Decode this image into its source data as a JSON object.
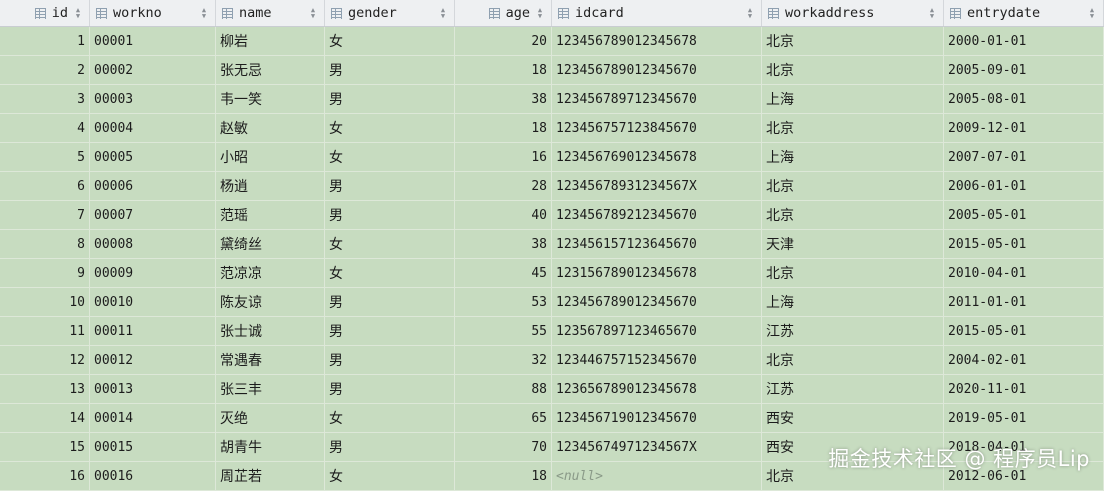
{
  "columns": [
    {
      "key": "id",
      "label": "id"
    },
    {
      "key": "workno",
      "label": "workno"
    },
    {
      "key": "name",
      "label": "name"
    },
    {
      "key": "gender",
      "label": "gender"
    },
    {
      "key": "age",
      "label": "age"
    },
    {
      "key": "idcard",
      "label": "idcard"
    },
    {
      "key": "workaddress",
      "label": "workaddress"
    },
    {
      "key": "entrydate",
      "label": "entrydate"
    }
  ],
  "rows": [
    {
      "id": "1",
      "workno": "00001",
      "name": "柳岩",
      "gender": "女",
      "age": "20",
      "idcard": "123456789012345678",
      "workaddress": "北京",
      "entrydate": "2000-01-01"
    },
    {
      "id": "2",
      "workno": "00002",
      "name": "张无忌",
      "gender": "男",
      "age": "18",
      "idcard": "123456789012345670",
      "workaddress": "北京",
      "entrydate": "2005-09-01"
    },
    {
      "id": "3",
      "workno": "00003",
      "name": "韦一笑",
      "gender": "男",
      "age": "38",
      "idcard": "123456789712345670",
      "workaddress": "上海",
      "entrydate": "2005-08-01"
    },
    {
      "id": "4",
      "workno": "00004",
      "name": "赵敏",
      "gender": "女",
      "age": "18",
      "idcard": "123456757123845670",
      "workaddress": "北京",
      "entrydate": "2009-12-01"
    },
    {
      "id": "5",
      "workno": "00005",
      "name": "小昭",
      "gender": "女",
      "age": "16",
      "idcard": "123456769012345678",
      "workaddress": "上海",
      "entrydate": "2007-07-01"
    },
    {
      "id": "6",
      "workno": "00006",
      "name": "杨逍",
      "gender": "男",
      "age": "28",
      "idcard": "12345678931234567X",
      "workaddress": "北京",
      "entrydate": "2006-01-01"
    },
    {
      "id": "7",
      "workno": "00007",
      "name": "范瑶",
      "gender": "男",
      "age": "40",
      "idcard": "123456789212345670",
      "workaddress": "北京",
      "entrydate": "2005-05-01"
    },
    {
      "id": "8",
      "workno": "00008",
      "name": "黛绮丝",
      "gender": "女",
      "age": "38",
      "idcard": "123456157123645670",
      "workaddress": "天津",
      "entrydate": "2015-05-01"
    },
    {
      "id": "9",
      "workno": "00009",
      "name": "范凉凉",
      "gender": "女",
      "age": "45",
      "idcard": "123156789012345678",
      "workaddress": "北京",
      "entrydate": "2010-04-01"
    },
    {
      "id": "10",
      "workno": "00010",
      "name": "陈友谅",
      "gender": "男",
      "age": "53",
      "idcard": "123456789012345670",
      "workaddress": "上海",
      "entrydate": "2011-01-01"
    },
    {
      "id": "11",
      "workno": "00011",
      "name": "张士诚",
      "gender": "男",
      "age": "55",
      "idcard": "123567897123465670",
      "workaddress": "江苏",
      "entrydate": "2015-05-01"
    },
    {
      "id": "12",
      "workno": "00012",
      "name": "常遇春",
      "gender": "男",
      "age": "32",
      "idcard": "123446757152345670",
      "workaddress": "北京",
      "entrydate": "2004-02-01"
    },
    {
      "id": "13",
      "workno": "00013",
      "name": "张三丰",
      "gender": "男",
      "age": "88",
      "idcard": "123656789012345678",
      "workaddress": "江苏",
      "entrydate": "2020-11-01"
    },
    {
      "id": "14",
      "workno": "00014",
      "name": "灭绝",
      "gender": "女",
      "age": "65",
      "idcard": "123456719012345670",
      "workaddress": "西安",
      "entrydate": "2019-05-01"
    },
    {
      "id": "15",
      "workno": "00015",
      "name": "胡青牛",
      "gender": "男",
      "age": "70",
      "idcard": "12345674971234567X",
      "workaddress": "西安",
      "entrydate": "2018-04-01"
    },
    {
      "id": "16",
      "workno": "00016",
      "name": "周芷若",
      "gender": "女",
      "age": "18",
      "idcard": "<null>",
      "workaddress": "北京",
      "entrydate": "2012-06-01"
    }
  ],
  "watermark": "掘金技术社区 @ 程序员Lip",
  "colors": {
    "row_bg": "#c7dcc0",
    "header_bg": "#eef0f2",
    "null_text": "#8a9a88"
  },
  "icons": {
    "column": "column-grid-icon",
    "sort": "sort-arrows-icon"
  }
}
